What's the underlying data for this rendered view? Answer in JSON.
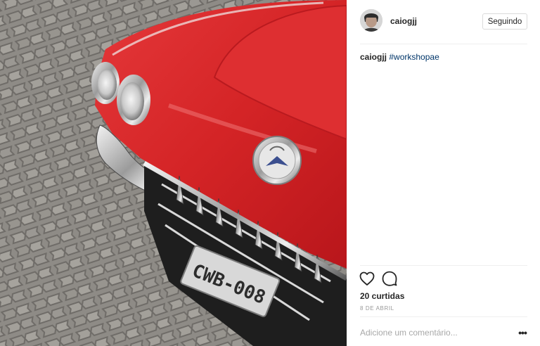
{
  "post": {
    "photo_description_icon": "photo",
    "plate_text": "CWB-008"
  },
  "header": {
    "username": "caiogjj",
    "follow_label": "Seguindo",
    "avatar_icon": "avatar-icon"
  },
  "caption": {
    "username": "caiogjj",
    "hashtag": "#workshopae"
  },
  "actions": {
    "like_icon": "heart-icon",
    "comment_icon": "comment-icon"
  },
  "likes_label": "20 curtidas",
  "date_label": "8 DE ABRIL",
  "comment": {
    "placeholder": "Adicione um comentário...",
    "more_label": "•••"
  },
  "colors": {
    "car_red": "#d7262a",
    "link": "#003569",
    "border": "#dbdbdb"
  }
}
